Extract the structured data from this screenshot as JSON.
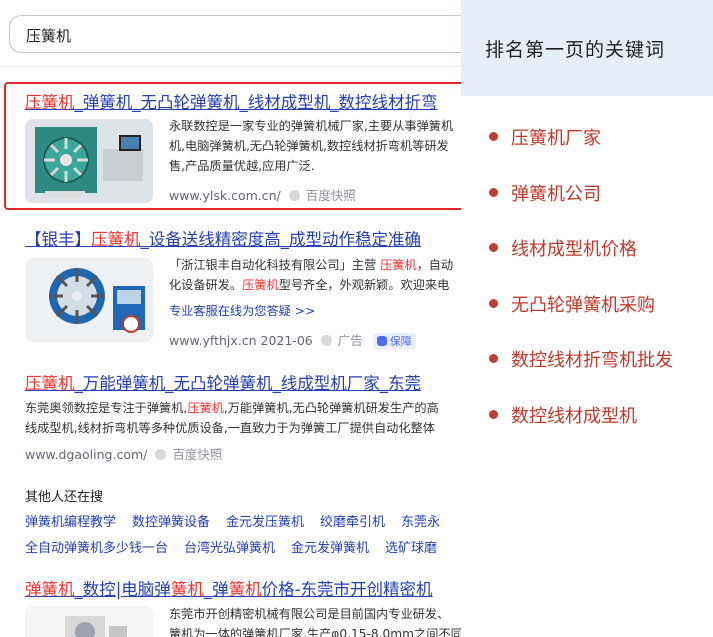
{
  "search": {
    "value": "压簧机"
  },
  "results": [
    {
      "title_hl": "压簧机",
      "title_rest": "_弹簧机_无凸轮弹簧机_线材成型机_数控线材折弯",
      "desc": [
        "永联数控是一家专业的弹簧机械厂家,主要从事弹簧机",
        "机,电脑弹簧机,无凸轮弹簧机,数控线材折弯机等研发",
        "售,产品质量优越,应用广泛."
      ],
      "url": "www.ylsk.com.cn/",
      "snapshot": "百度快照"
    },
    {
      "title_pre": "【银丰】",
      "title_hl": "压簧机",
      "title_rest": "_设备送线精密度高_成型动作稳定准确",
      "desc1_pre": "「浙江银丰自动化科技有限公司」主营 ",
      "desc1_hl": "压簧机",
      "desc1_post": "，自动",
      "desc2_pre": "化设备研发。",
      "desc2_hl": "压簧机",
      "desc2_post": "型号齐全，外观新颖。欢迎来电",
      "service_link": "专业客服在线为您答疑 >>",
      "url": "www.yfthjx.cn",
      "date": "2021-06",
      "ad": "广告",
      "guarantee": "保障"
    },
    {
      "title_hl": "压簧机",
      "title_rest": "_万能弹簧机_无凸轮弹簧机_线成型机厂家_东莞",
      "desc1_pre": "东莞奥领数控是专注于弹簧机,",
      "desc1_hl": "压簧机",
      "desc1_post": ",万能弹簧机,无凸轮弹簧机研发生产的高",
      "desc2": "线成型机,线材折弯机等多种优质设备,一直致力于为弹簧工厂提供自动化整体",
      "url": "www.dgaoling.com/",
      "snapshot": "百度快照"
    },
    {
      "t1": "弹簧机",
      "t2": "_数控",
      "t3": "|电脑弹",
      "t4": "簧机",
      "t5": "_弹",
      "t6": "簧机",
      "t7": "价格-东莞市开创精密机",
      "desc1": "东莞市开创精密机械有限公司是目前国内专业研发、",
      "desc2": "簧机为一体的弹簧机厂家,生产φ0.15-8.0mm之间不同"
    }
  ],
  "others": {
    "title": "其他人还在搜",
    "row1": [
      "弹簧机编程教学",
      "数控弹簧设备",
      "金元发压簧机",
      "绞磨牵引机",
      "东莞永"
    ],
    "row2": [
      "全自动弹簧机多少钱一台",
      "台湾光弘弹簧机",
      "金元发弹簧机",
      "选矿球磨"
    ]
  },
  "sidebar": {
    "title": "排名第一页的关键词",
    "keywords": [
      "压簧机厂家",
      "弹簧机公司",
      "线材成型机价格",
      "无凸轮弹簧机采购",
      "数控线材折弯机批发",
      "数控线材成型机"
    ]
  }
}
